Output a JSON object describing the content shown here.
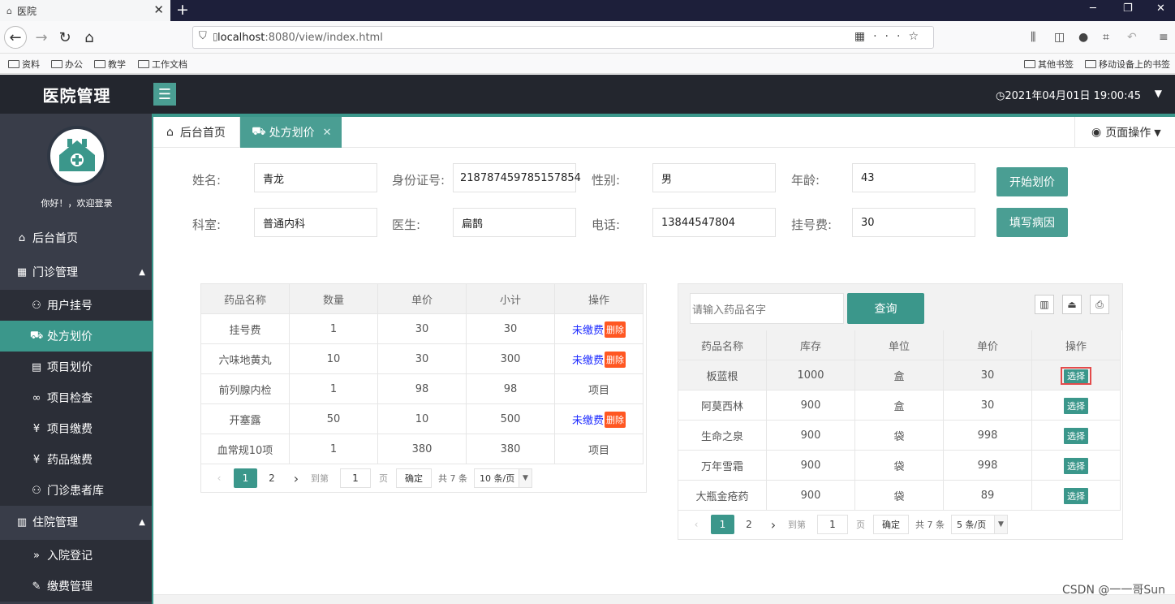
{
  "browser": {
    "tab_title": "医院",
    "url_host": "localhost",
    "url_path": ":8080/view/index.html",
    "bookmarks_left": [
      "资料",
      "办公",
      "教学",
      "工作文档"
    ],
    "bookmarks_right": [
      "其他书签",
      "移动设备上的书签"
    ]
  },
  "app": {
    "title": "医院管理",
    "datetime": "2021年04月01日 19:00:45"
  },
  "sidebar": {
    "greeting": "你好！，欢迎登录",
    "home": "后台首页",
    "groups": [
      {
        "label": "门诊管理",
        "items": [
          "用户挂号",
          "处方划价",
          "项目划价",
          "项目检查",
          "项目缴费",
          "药品缴费",
          "门诊患者库"
        ]
      },
      {
        "label": "住院管理",
        "items": [
          "入院登记",
          "缴费管理"
        ]
      }
    ]
  },
  "tabs": {
    "home": "后台首页",
    "current": "处方划价",
    "page_ops": "页面操作"
  },
  "form": {
    "name_label": "姓名:",
    "name_value": "青龙",
    "id_label": "身份证号:",
    "id_value": "218787459785157854",
    "gender_label": "性别:",
    "gender_value": "男",
    "age_label": "年龄:",
    "age_value": "43",
    "dept_label": "科室:",
    "dept_value": "普通内科",
    "doctor_label": "医生:",
    "doctor_value": "扁鹊",
    "phone_label": "电话:",
    "phone_value": "13844547804",
    "fee_label": "挂号费:",
    "fee_value": "30",
    "start_btn": "开始划价",
    "diag_btn": "填写病因"
  },
  "left_table": {
    "headers": [
      "药品名称",
      "数量",
      "单价",
      "小计",
      "操作"
    ],
    "unpaid_label": "未缴费",
    "delete_label": "删除",
    "rows": [
      {
        "name": "挂号费",
        "qty": "1",
        "price": "30",
        "subtotal": "30",
        "op": ""
      },
      {
        "name": "六味地黄丸",
        "qty": "10",
        "price": "30",
        "subtotal": "300",
        "op": ""
      },
      {
        "name": "前列腺内检",
        "qty": "1",
        "price": "98",
        "subtotal": "98",
        "op": "项目"
      },
      {
        "name": "开塞露",
        "qty": "50",
        "price": "10",
        "subtotal": "500",
        "op": ""
      },
      {
        "name": "血常规10项",
        "qty": "1",
        "price": "380",
        "subtotal": "380",
        "op": "项目"
      }
    ],
    "pager": {
      "prev": "‹",
      "page1": "1",
      "page2": "2",
      "next": "›",
      "goto": "到第",
      "page_input": "1",
      "page_unit": "页",
      "confirm": "确定",
      "total": "共 7 条",
      "size": "10 条/页"
    }
  },
  "right_panel": {
    "search_placeholder": "请输入药品名字",
    "query_btn": "查询",
    "headers": [
      "药品名称",
      "库存",
      "单位",
      "单价",
      "操作"
    ],
    "select_label": "选择",
    "rows": [
      {
        "name": "板蓝根",
        "stock": "1000",
        "unit": "盒",
        "price": "30"
      },
      {
        "name": "阿莫西林",
        "stock": "900",
        "unit": "盒",
        "price": "30"
      },
      {
        "name": "生命之泉",
        "stock": "900",
        "unit": "袋",
        "price": "998"
      },
      {
        "name": "万年雪霜",
        "stock": "900",
        "unit": "袋",
        "price": "998"
      },
      {
        "name": "大瓶金疮药",
        "stock": "900",
        "unit": "袋",
        "price": "89"
      }
    ],
    "pager": {
      "prev": "‹",
      "page1": "1",
      "page2": "2",
      "next": "›",
      "goto": "到第",
      "page_input": "1",
      "page_unit": "页",
      "confirm": "确定",
      "total": "共 7 条",
      "size": "5 条/页"
    }
  },
  "watermark": "CSDN @一一哥Sun",
  "colors": {
    "accent": "#3b978b",
    "header": "#23262e",
    "sidebar": "#393d49",
    "danger": "#ff5722",
    "link": "#1e2cff"
  }
}
